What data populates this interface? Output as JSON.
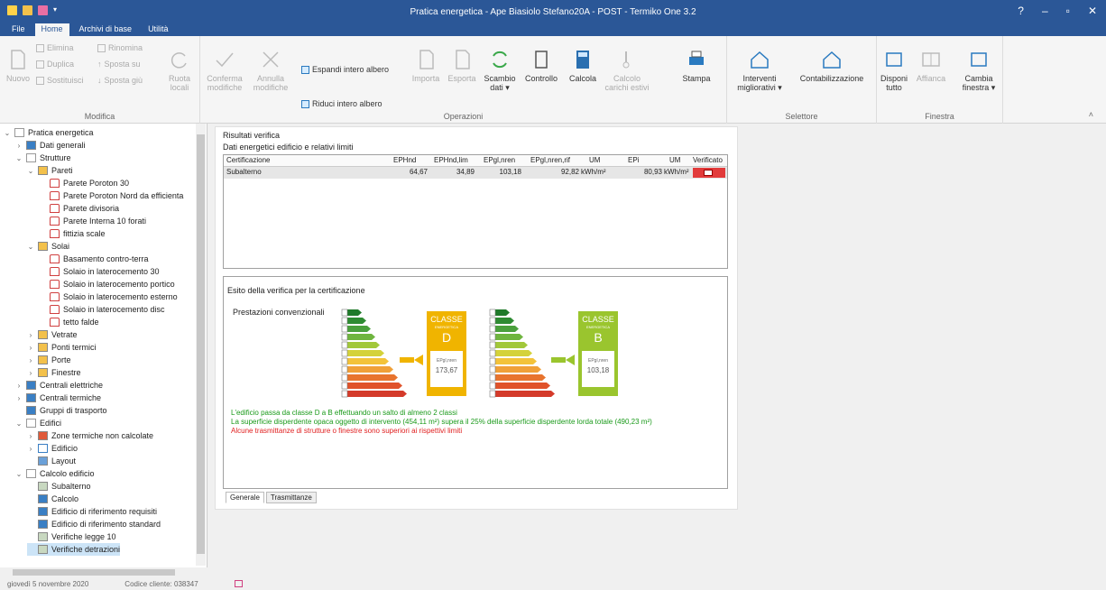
{
  "window": {
    "title": "Pratica energetica - Ape Biasiolo Stefano20A - POST - Termiko One 3.2",
    "buttons": [
      "?",
      "–",
      "▫",
      "✕"
    ]
  },
  "menu_tabs": [
    "File",
    "Home",
    "Archivi di base",
    "Utilità"
  ],
  "ribbon": {
    "nuovo": "Nuovo",
    "elimina": "Elimina",
    "duplica": "Duplica",
    "sostituisci": "Sostituisci",
    "rinomina": "Rinomina",
    "sposta_su": "Sposta su",
    "sposta_giu": "Sposta giù",
    "ruota_locali": "Ruota locali",
    "group_modifica": "Modifica",
    "conferma": "Conferma modifiche",
    "annulla": "Annulla modifiche",
    "espandi": "Espandi intero albero",
    "riduci": "Riduci intero albero",
    "importa": "Importa",
    "esporta": "Esporta",
    "scambio": "Scambio dati ▾",
    "controllo": "Controllo",
    "calcola": "Calcola",
    "calcolo_estivi": "Calcolo carichi estivi",
    "stampa": "Stampa",
    "group_operazioni": "Operazioni",
    "interventi": "Interventi migliorativi ▾",
    "contabilizzazione": "Contabilizzazione",
    "group_selettore": "Selettore",
    "disponi": "Disponi tutto",
    "affianca": "Affianca",
    "cambia": "Cambia finestra ▾",
    "group_finestra": "Finestra"
  },
  "tree": [
    {
      "label": "Pratica energetica",
      "level": 0,
      "toggle": "v",
      "icon": "doc"
    },
    {
      "label": "Dati generali",
      "level": 1,
      "toggle": ">",
      "icon": "blue"
    },
    {
      "label": "Strutture",
      "level": 1,
      "toggle": "v",
      "icon": "doc"
    },
    {
      "label": "Pareti",
      "level": 2,
      "toggle": "v",
      "icon": "folder"
    },
    {
      "label": "Parete Poroton 30",
      "level": 3,
      "toggle": "",
      "icon": "house"
    },
    {
      "label": "Parete Poroton Nord da efficienta",
      "level": 3,
      "toggle": "",
      "icon": "house"
    },
    {
      "label": "Parete divisoria",
      "level": 3,
      "toggle": "",
      "icon": "house"
    },
    {
      "label": "Parete Interna 10 forati",
      "level": 3,
      "toggle": "",
      "icon": "house"
    },
    {
      "label": "fittizia scale",
      "level": 3,
      "toggle": "",
      "icon": "house"
    },
    {
      "label": "Solai",
      "level": 2,
      "toggle": "v",
      "icon": "folder"
    },
    {
      "label": "Basamento contro-terra",
      "level": 3,
      "toggle": "",
      "icon": "house"
    },
    {
      "label": "Solaio in laterocemento 30",
      "level": 3,
      "toggle": "",
      "icon": "house"
    },
    {
      "label": "Solaio in laterocemento portico",
      "level": 3,
      "toggle": "",
      "icon": "house"
    },
    {
      "label": "Solaio in laterocemento esterno",
      "level": 3,
      "toggle": "",
      "icon": "house"
    },
    {
      "label": "Solaio in laterocemento disc",
      "level": 3,
      "toggle": "",
      "icon": "house"
    },
    {
      "label": "tetto falde",
      "level": 3,
      "toggle": "",
      "icon": "house"
    },
    {
      "label": "Vetrate",
      "level": 2,
      "toggle": ">",
      "icon": "folder"
    },
    {
      "label": "Ponti termici",
      "level": 2,
      "toggle": ">",
      "icon": "folder"
    },
    {
      "label": "Porte",
      "level": 2,
      "toggle": ">",
      "icon": "folder"
    },
    {
      "label": "Finestre",
      "level": 2,
      "toggle": ">",
      "icon": "folder"
    },
    {
      "label": "Centrali elettriche",
      "level": 1,
      "toggle": ">",
      "icon": "blue"
    },
    {
      "label": "Centrali termiche",
      "level": 1,
      "toggle": ">",
      "icon": "blue"
    },
    {
      "label": "Gruppi di trasporto",
      "level": 1,
      "toggle": "",
      "icon": "blue"
    },
    {
      "label": "Edifici",
      "level": 1,
      "toggle": "v",
      "icon": "doc"
    },
    {
      "label": "Zone termiche non calcolate",
      "level": 2,
      "toggle": ">",
      "icon": "multi"
    },
    {
      "label": "Edificio",
      "level": 2,
      "toggle": ">",
      "icon": "housebl"
    },
    {
      "label": "Layout",
      "level": 2,
      "toggle": "",
      "icon": "layout"
    },
    {
      "label": "Calcolo edificio",
      "level": 1,
      "toggle": "v",
      "icon": "doc"
    },
    {
      "label": "Subalterno",
      "level": 2,
      "toggle": "",
      "icon": "grid"
    },
    {
      "label": "Calcolo",
      "level": 2,
      "toggle": "",
      "icon": "blue"
    },
    {
      "label": "Edificio di riferimento requisiti",
      "level": 2,
      "toggle": "",
      "icon": "blue"
    },
    {
      "label": "Edificio di riferimento standard",
      "level": 2,
      "toggle": "",
      "icon": "blue"
    },
    {
      "label": "Verifiche legge 10",
      "level": 2,
      "toggle": "",
      "icon": "grid"
    },
    {
      "label": "Verifiche detrazioni",
      "level": 2,
      "toggle": "",
      "icon": "grid",
      "selected": true
    }
  ],
  "results": {
    "title": "Risultati verifica",
    "subtitle": "Dati energetici edificio e relativi limiti",
    "columns": [
      "Certificazione",
      "EPHnd",
      "EPHnd,lim",
      "EPgl,nren",
      "EPgl,nren,rif",
      "UM",
      "EPi",
      "UM",
      "Verificato"
    ],
    "row": [
      "Subalterno",
      "64,67",
      "34,89",
      "103,18",
      "92,82",
      "kWh/m²",
      "80,93",
      "kWh/m²",
      ""
    ]
  },
  "esito": {
    "title": "Esito della verifica per la certificazione",
    "label": "Prestazioni convenzionali",
    "classe_label": "CLASSE",
    "classe_sub": "ENERGETICA",
    "before": {
      "classe": "D",
      "indicator": "EPgl,nren",
      "value": "173,67",
      "color": "#f0b400"
    },
    "after": {
      "classe": "B",
      "indicator": "EPgl,nren",
      "value": "103,18",
      "color": "#9ac52e"
    },
    "scale_colors": [
      "#1f7a2a",
      "#2e8b32",
      "#4aa03c",
      "#6fb53f",
      "#a2c83a",
      "#d4d23a",
      "#f3c33a",
      "#f0a038",
      "#e8742e",
      "#e0522a",
      "#d43a2a"
    ],
    "messages": [
      {
        "text": "L'edificio passa da classe D a B effettuando un salto di almeno 2 classi",
        "color": "#1a9a1a"
      },
      {
        "text": "La superficie disperdente opaca oggetto di intervento (454,11 m²) supera il 25% della superficie disperdente lorda totale (490,23 m²)",
        "color": "#1a9a1a"
      },
      {
        "text": "Alcune trasmittanze di strutture o finestre sono superiori ai rispettivi limiti",
        "color": "#e02020"
      }
    ]
  },
  "subtabs": [
    "Generale",
    "Trasmittanze"
  ],
  "status": {
    "date": "giovedì 5 novembre 2020",
    "code": "Codice cliente: 038347"
  }
}
